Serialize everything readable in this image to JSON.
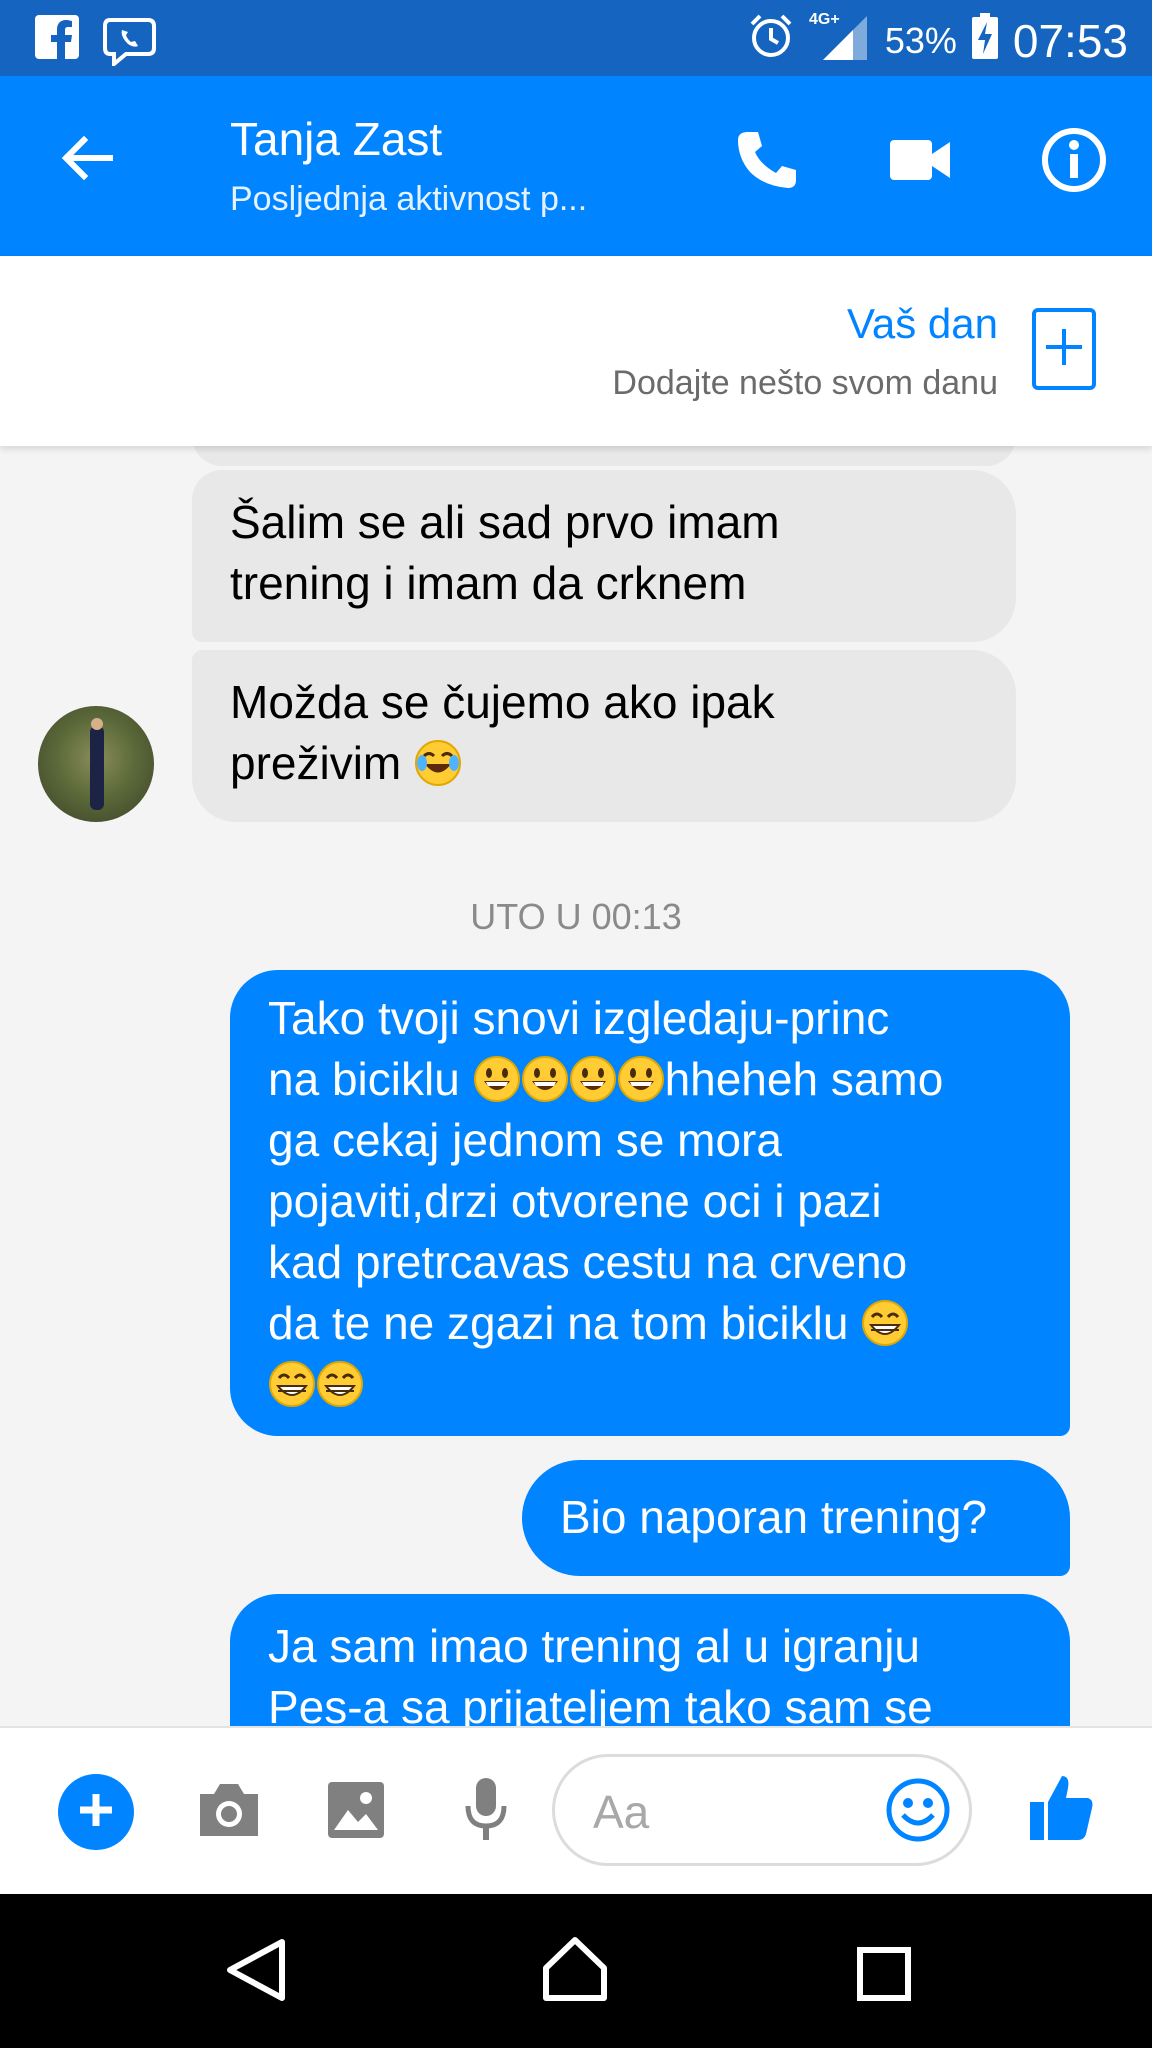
{
  "status_bar": {
    "network": "4G+",
    "battery": "53%",
    "time": "07:53"
  },
  "header": {
    "contact_name": "Tanja Zast",
    "contact_status": "Posljednja aktivnost p..."
  },
  "your_day": {
    "title": "Vaš dan",
    "subtitle": "Dodajte nešto svom danu"
  },
  "messages": {
    "incoming": [
      {
        "line1": "Šalim se ali sad prvo imam",
        "line2": "trening i imam da crknem"
      },
      {
        "line1": "Možda se čujemo ako ipak",
        "line2": "preživim"
      }
    ],
    "timestamp": "UTO U 00:13",
    "outgoing": [
      {
        "l1": "Tako tvoji snovi izgledaju-princ",
        "l2a": "na biciklu ",
        "l2b": "hheheh samo",
        "l3": "ga cekaj jednom se mora",
        "l4": "pojaviti,drzi otvorene oci i pazi",
        "l5": "kad pretrcavas cestu na crveno",
        "l6": "da te ne zgazi na tom biciklu "
      },
      {
        "text": "Bio naporan trening?"
      },
      {
        "line1": "Ja sam imao trening al u igranju",
        "line2": "Pes-a sa prijateljem tako sam se"
      }
    ]
  },
  "composer": {
    "placeholder": "Aa"
  },
  "colors": {
    "messenger_blue": "#0084ff",
    "status_bar": "#1565c0",
    "incoming_bubble": "#e8e8e8"
  },
  "icons": [
    "facebook-icon",
    "viber-icon",
    "alarm-icon",
    "signal-icon",
    "battery-icon",
    "back-arrow-icon",
    "phone-icon",
    "video-icon",
    "info-icon",
    "plus-icon",
    "camera-icon",
    "gallery-icon",
    "microphone-icon",
    "emoji-icon",
    "thumbs-up-icon",
    "nav-back-icon",
    "nav-home-icon",
    "nav-recents-icon"
  ]
}
